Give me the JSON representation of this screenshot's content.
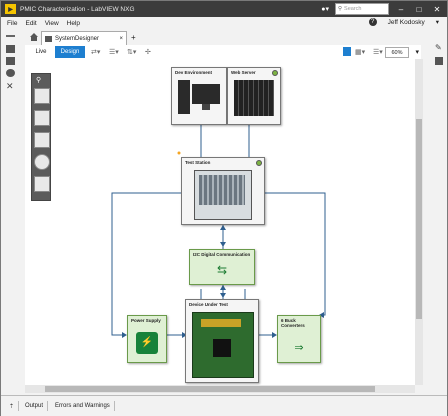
{
  "window": {
    "title": "PMIC Characterization - LabVIEW NXG",
    "search_placeholder": "Search"
  },
  "menu": {
    "file": "File",
    "edit": "Edit",
    "view": "View",
    "help": "Help"
  },
  "user": {
    "name": "Jeff Kodosky"
  },
  "tabs": {
    "document": "SystemDesigner",
    "close": "×",
    "add": "+"
  },
  "modes": {
    "live": "Live",
    "design": "Design"
  },
  "zoom": {
    "value": "60%"
  },
  "nodes": {
    "dev_env": "Dev Environment",
    "web_server": "Web Server",
    "test_station": "Test Station",
    "i2c": "I2C Digital Communication",
    "dut": "Device Under Test",
    "power_supply": "Power Supply",
    "buck": "6 Buck Converters"
  },
  "status": {
    "output": "Output",
    "errors": "Errors and Warnings"
  },
  "colors": {
    "accent": "#1e7fd0",
    "link_line": "#2f5f8f",
    "green_node": "#dff0d4"
  }
}
